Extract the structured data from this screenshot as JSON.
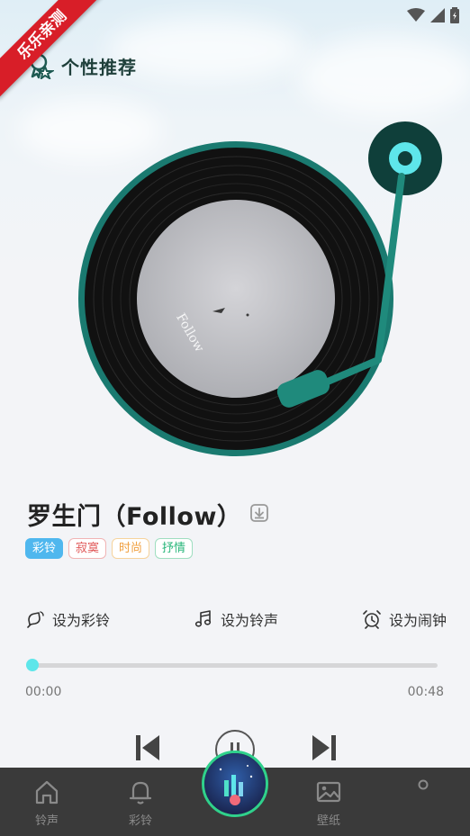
{
  "debug_ribbon": "乐乐亲测",
  "header": {
    "title": "个性推荐"
  },
  "song": {
    "title": "罗生门（Follow）",
    "tags": [
      "彩铃",
      "寂寞",
      "时尚",
      "抒情"
    ]
  },
  "actions": [
    {
      "label": "设为彩铃",
      "icon": "ringtone-broadcast-icon"
    },
    {
      "label": "设为铃声",
      "icon": "music-note-icon"
    },
    {
      "label": "设为闹钟",
      "icon": "alarm-clock-icon"
    }
  ],
  "player": {
    "current_time": "00:00",
    "total_time": "00:48",
    "progress": 0.0
  },
  "tabbar": {
    "items": [
      {
        "label": "铃声",
        "icon": "home-icon"
      },
      {
        "label": "彩铃",
        "icon": "bell-icon"
      },
      {
        "label": "",
        "icon": "center-album-icon"
      },
      {
        "label": "壁纸",
        "icon": "image-icon"
      },
      {
        "label": "",
        "icon": "profile-icon"
      }
    ]
  },
  "colors": {
    "accent": "#5ee6ea",
    "record_rim": "#1a7a70",
    "tonearm": "#1f8a7c",
    "tabbar_bg": "#3a3a3a"
  }
}
